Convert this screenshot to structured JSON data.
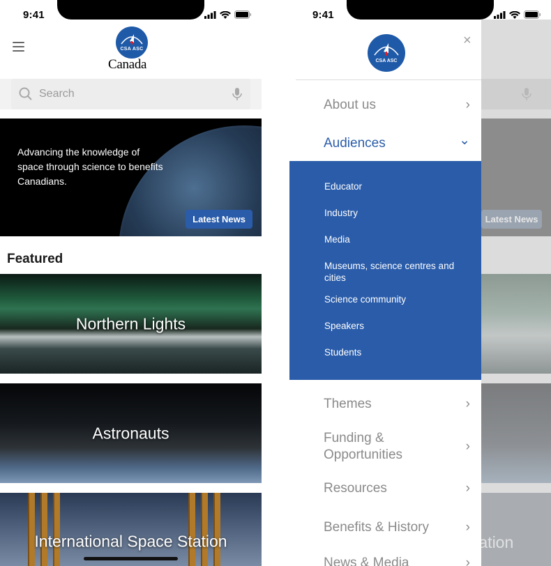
{
  "status_bar": {
    "time": "9:41"
  },
  "left_screen": {
    "logo": {
      "csa_text": "CSA ASC",
      "canada_wordmark": "Canada"
    },
    "search": {
      "placeholder": "Search"
    },
    "hero": {
      "tagline": "Advancing the knowledge of space through science to benefits Canadians.",
      "button_label": "Latest News"
    },
    "featured": {
      "title": "Featured",
      "cards": [
        {
          "label": "Northern Lights"
        },
        {
          "label": "Astronauts"
        },
        {
          "label": "International Space Station"
        }
      ]
    }
  },
  "right_screen": {
    "logo": {
      "csa_text": "CSA ASC"
    },
    "close_glyph": "×",
    "background_button_label": "Latest News",
    "background_card_fragment": "tation",
    "menu": [
      {
        "label": "About us",
        "chevron": "›"
      },
      {
        "label": "Audiences",
        "chevron": "⌄",
        "expanded": true
      },
      {
        "label": "Themes",
        "chevron": "›"
      },
      {
        "label": "Funding & Opportunities",
        "chevron": "›"
      },
      {
        "label": "Resources",
        "chevron": "›"
      },
      {
        "label": "Benefits & History",
        "chevron": "›"
      },
      {
        "label": "News & Media",
        "chevron": "›"
      }
    ],
    "audiences_submenu": [
      "Educator",
      "Industry",
      "Media",
      "Museums, science centres and cities",
      "Science community",
      "Speakers",
      "Students"
    ]
  },
  "colors": {
    "brand_blue": "#2a5caa",
    "csa_badge_blue": "#1f5aa8"
  }
}
